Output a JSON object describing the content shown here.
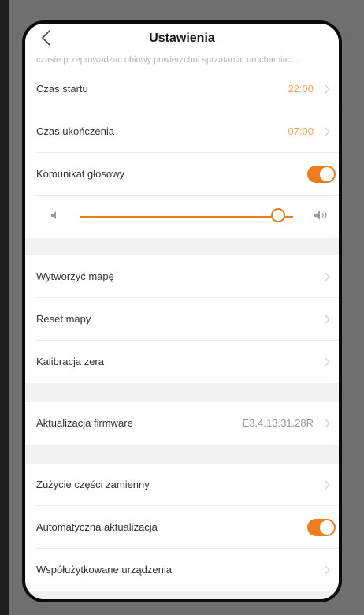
{
  "header": {
    "title": "Ustawienia",
    "subtext": "czasie przeprowadzac obiowy powierzchni sprzatania, uruchamiac..."
  },
  "schedule": {
    "start": {
      "label": "Czas startu",
      "value": "22:00"
    },
    "end": {
      "label": "Czas ukończenia",
      "value": "07:00"
    }
  },
  "voice": {
    "label": "Komunikat głosowy",
    "enabled": true,
    "volume": 0.93
  },
  "map": {
    "create": "Wytworzyć mapę",
    "reset": "Reset mapy",
    "calibrate": "Kalibracja zera"
  },
  "firmware": {
    "label": "Aktualizacja firmware",
    "version": "E3.4.13.31.28R"
  },
  "other": {
    "parts": "Zużycie części zamienny",
    "auto_update": {
      "label": "Automatyczna aktualizacja",
      "enabled": true
    },
    "shared": "Współużytkowane urządzenia"
  },
  "colors": {
    "accent": "#ee7d1e",
    "value_text": "#f7a653",
    "section_gap": "#f2f2f2"
  },
  "icons": [
    "chevron-left-icon",
    "chevron-right-icon",
    "volume-low-icon",
    "volume-high-icon"
  ]
}
